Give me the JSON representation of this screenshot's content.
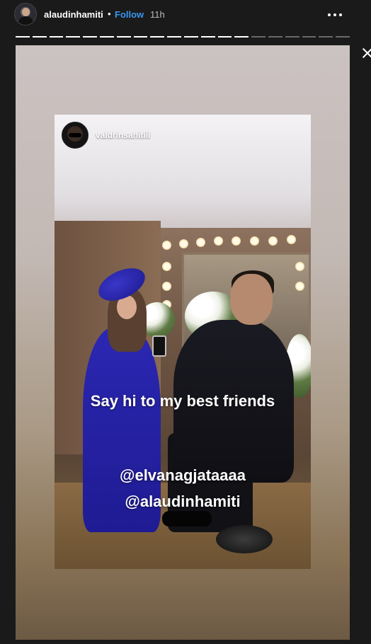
{
  "header": {
    "username": "alaudinhamiti",
    "separator": "•",
    "follow_label": "Follow",
    "time": "11h"
  },
  "progress": {
    "segments_total": 20,
    "segments_viewed": 14
  },
  "story": {
    "embedded_username": "valdrinsahitiii",
    "caption": "Say hi to my best friends",
    "mention_1": "@elvanagjataaaa",
    "mention_2": "@alaudinhamiti"
  },
  "colors": {
    "follow": "#3897f0",
    "background": "#1a1a1a"
  },
  "icons": {
    "more": "more-options-icon",
    "close": "close-icon"
  }
}
